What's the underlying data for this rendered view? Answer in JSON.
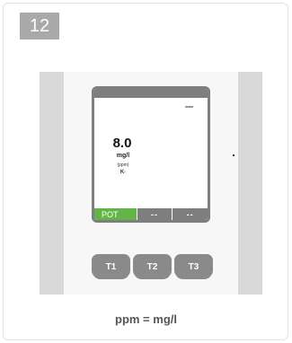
{
  "badge": {
    "number": "12"
  },
  "screen": {
    "value": "8.0",
    "unit": "mg/l",
    "alt_unit": "(ppm)",
    "ion": "K·",
    "tabs": [
      {
        "label": "POT",
        "active": true
      },
      {
        "label": "--",
        "active": false
      },
      {
        "label": "--",
        "active": false
      }
    ]
  },
  "keys": [
    {
      "label": "T1"
    },
    {
      "label": "T2"
    },
    {
      "label": "T3"
    }
  ],
  "caption": "ppm = mg/l",
  "colors": {
    "active_tab": "#63b548",
    "device_gray": "#7e7e7e",
    "badge": "#a9a9a9"
  }
}
